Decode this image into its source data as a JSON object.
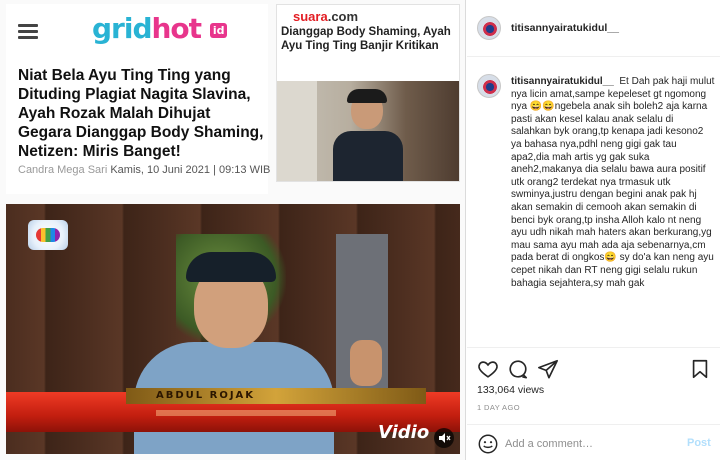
{
  "article": {
    "logo_main": "gridhot",
    "logo_suffix": "id",
    "title": "Niat Bela Ayu Ting Ting yang Dituding Plagiat Nagita Slavina, Ayah Rozak Malah Dihujat Gegara Dianggap Body Shaming, Netizen: Miris Banget!",
    "author": "Candra Mega Sari",
    "date": "Kamis, 10 Juni 2021 | 09:13 WIB"
  },
  "suara": {
    "logo_main": "suara",
    "logo_suffix": ".com",
    "title": "Dianggap Body Shaming, Ayah Ayu Ting Ting Banjir Kritikan"
  },
  "video": {
    "name_strip": "ABDUL ROJAK",
    "watermark": "Vidio"
  },
  "post": {
    "username": "titisannyairatukidul__",
    "caption": "Et Dah pak haji mulut nya licin amat,sampe kepeleset gt ngomong nya 😄😄ngebela anak sih boleh2 aja karna pasti akan kesel kalau anak selalu di salahkan byk orang,tp kenapa jadi kesono2 ya bahasa nya,pdhl neng gigi gak tau apa2,dia mah artis yg gak suka aneh2,makanya dia selalu bawa aura positif utk orang2 terdekat nya trmasuk utk swminya,justru dengan begini anak pak hj akan semakin di cemooh akan semakin di benci byk orang,tp insha Alloh kalo nt neng ayu udh nikah mah haters akan berkurang,yg mau sama ayu mah ada aja sebenarnya,cm pada berat di ongkos😄 sy do'a kan neng ayu cepet nikah dan RT neng gigi selalu rukun bahagia sejahtera,sy mah gak",
    "views": "133,064 views",
    "time_ago": "1 DAY AGO",
    "comment_placeholder": "Add a comment…",
    "post_label": "Post"
  },
  "icons": {
    "like": "heart-icon",
    "comment": "comment-icon",
    "share": "share-icon",
    "save": "bookmark-icon",
    "emoji": "emoji-icon",
    "mute": "speaker-mute-icon",
    "menu": "hamburger-icon"
  },
  "colors": {
    "instagram_link": "#b2dffc",
    "gridhot_blue": "#29b3d4",
    "gridhot_pink": "#e8358c",
    "suara_red": "#e31e24",
    "lower_third_red": "#c21e0f"
  }
}
